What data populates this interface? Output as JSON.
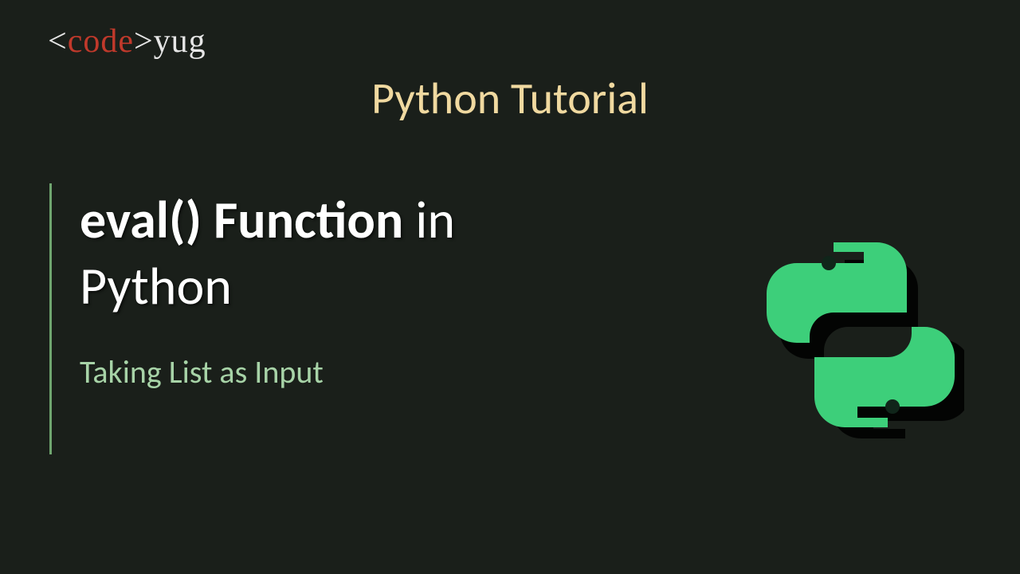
{
  "logo": {
    "open_angle": "<",
    "code_text": "code",
    "close_angle": ">",
    "suffix": "yug"
  },
  "header": {
    "title": "Python Tutorial"
  },
  "main": {
    "title_bold": "eval() Function",
    "title_rest_inline": " in",
    "title_line2": "Python",
    "subtitle": "Taking List as Input"
  },
  "icon": {
    "name": "python-logo",
    "color_fill": "#3dcf7a",
    "color_shadow": "#000000"
  }
}
